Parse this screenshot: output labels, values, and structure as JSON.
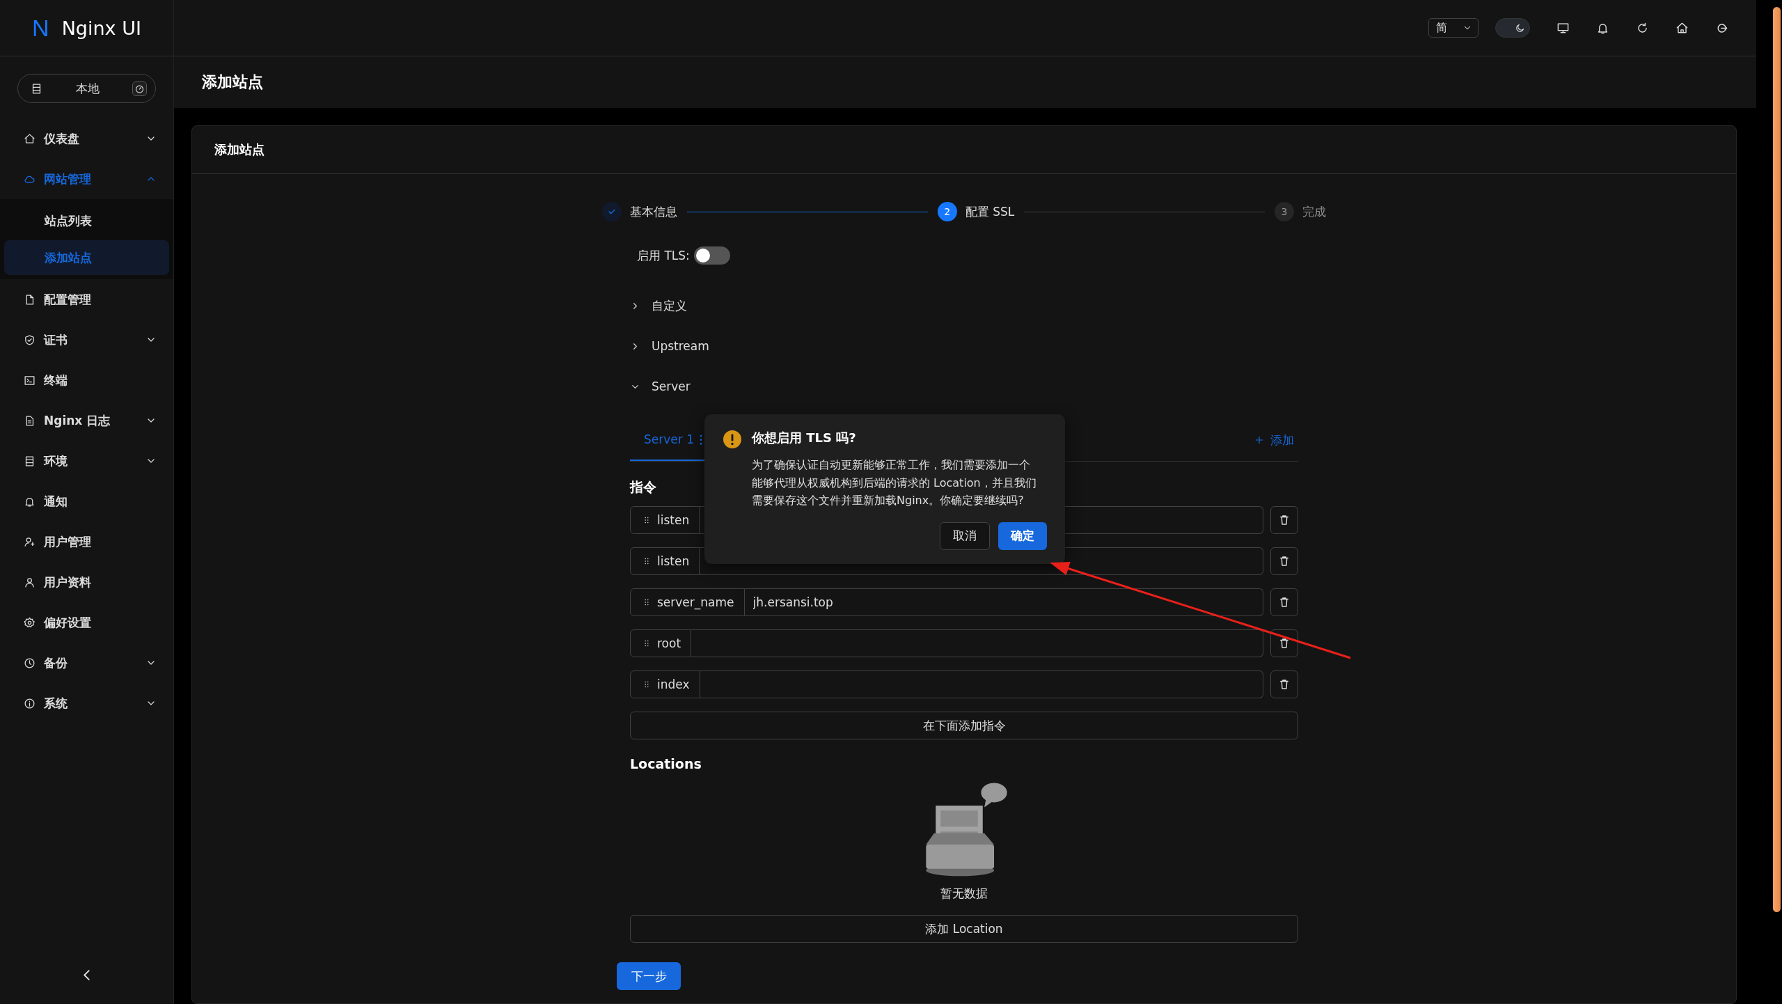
{
  "app": {
    "logo_mark": "N",
    "name": "Nginx UI"
  },
  "node_switch": {
    "label": "本地"
  },
  "sidebar": {
    "items": [
      {
        "label": "仪表盘",
        "selected": false,
        "expanded": false
      },
      {
        "label": "网站管理",
        "selected": true,
        "expanded": true,
        "children": [
          {
            "label": "站点列表",
            "selected": false
          },
          {
            "label": "添加站点",
            "selected": true
          }
        ]
      },
      {
        "label": "配置管理",
        "selected": false
      },
      {
        "label": "证书",
        "selected": false,
        "expanded": false
      },
      {
        "label": "终端",
        "selected": false
      },
      {
        "label": "Nginx 日志",
        "selected": false,
        "expanded": false
      },
      {
        "label": "环境",
        "selected": false,
        "expanded": false
      },
      {
        "label": "通知",
        "selected": false
      },
      {
        "label": "用户管理",
        "selected": false
      },
      {
        "label": "用户资料",
        "selected": false
      },
      {
        "label": "偏好设置",
        "selected": false
      },
      {
        "label": "备份",
        "selected": false,
        "expanded": false
      },
      {
        "label": "系统",
        "selected": false,
        "expanded": false
      }
    ]
  },
  "header": {
    "language": "简",
    "dark_mode": true
  },
  "page_title": "添加站点",
  "card": {
    "title": "添加站点"
  },
  "steps": [
    {
      "label": "基本信息",
      "kind": "finish"
    },
    {
      "number": "2",
      "label": "配置 SSL",
      "kind": "process"
    },
    {
      "number": "3",
      "label": "完成",
      "kind": "wait"
    }
  ],
  "tls": {
    "label": "启用 TLS:",
    "on": false
  },
  "collapses": [
    {
      "label": "自定义",
      "expanded": false
    },
    {
      "label": "Upstream",
      "expanded": false
    },
    {
      "label": "Server",
      "expanded": true
    }
  ],
  "server_tabs": {
    "tabs": [
      {
        "label": "Server 1",
        "selected": true
      }
    ],
    "add": "添加"
  },
  "directives": {
    "title": "指令",
    "rows": [
      {
        "name": "listen"
      },
      {
        "name": "listen"
      },
      {
        "name": "server_name",
        "value": "jh.ersansi.top"
      },
      {
        "name": "root"
      },
      {
        "name": "index"
      }
    ],
    "add_button": "在下面添加指令"
  },
  "locations": {
    "title": "Locations",
    "empty_text": "暂无数据",
    "add_button": "添加 Location"
  },
  "next_button": "下一步",
  "popconfirm": {
    "title": "你想启用 TLS 吗?",
    "message": "为了确保认证自动更新能够正常工作，我们需要添加一个能够代理从权威机构到后端的请求的 Location，并且我们需要保存这个文件并重新加载Nginx。你确定要继续吗?",
    "cancel": "取消",
    "ok": "确定"
  }
}
